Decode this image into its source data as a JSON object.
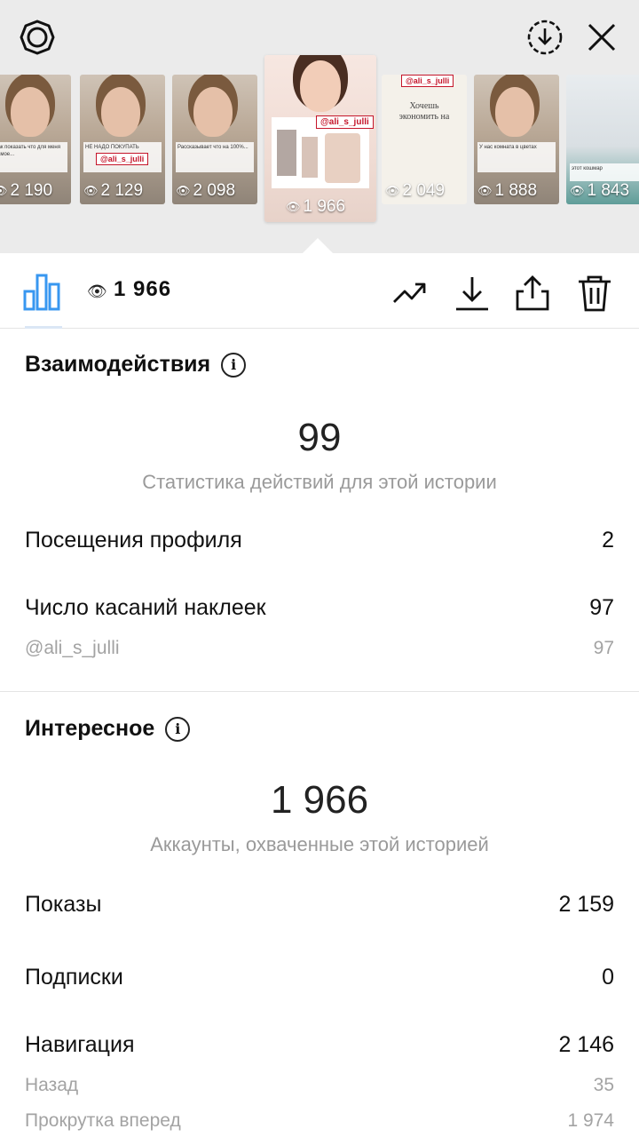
{
  "stories": [
    {
      "views": "2 190",
      "kind": "face",
      "caption": "Как показать что для меня самое..."
    },
    {
      "views": "2 129",
      "kind": "face",
      "caption": "НЕ НАДО ПОКУПАТЬ",
      "tag": "@ali_s_julli"
    },
    {
      "views": "2 098",
      "kind": "face",
      "caption": "Рассказывает что на 100%..."
    },
    {
      "views": "1 966",
      "kind": "selected",
      "tag": "@ali_s_julli",
      "selected": true
    },
    {
      "views": "2 049",
      "kind": "text",
      "caption": "Хочешь экономить на",
      "tag": "@ali_s_julli"
    },
    {
      "views": "1 888",
      "kind": "face",
      "caption": "У нас комната в цветах"
    },
    {
      "views": "1 843",
      "kind": "room",
      "caption": "этот кошмар"
    }
  ],
  "toolbar": {
    "view_count": "1 966"
  },
  "interactions": {
    "title": "Взаимодействия",
    "total": "99",
    "caption": "Статистика действий для этой истории",
    "rows": [
      {
        "label": "Посещения профиля",
        "value": "2"
      },
      {
        "label": "Число касаний наклеек",
        "value": "97"
      },
      {
        "label": "@ali_s_julli",
        "value": "97",
        "sub": true
      }
    ]
  },
  "discovery": {
    "title": "Интересное",
    "total": "1 966",
    "caption": "Аккаунты, охваченные этой историей",
    "rows": [
      {
        "label": "Показы",
        "value": "2 159"
      },
      {
        "label": "Подписки",
        "value": "0"
      },
      {
        "label": "Навигация",
        "value": "2 146"
      },
      {
        "label": "Назад",
        "value": "35",
        "sub": true
      },
      {
        "label": "Прокрутка вперед",
        "value": "1 974",
        "sub": true
      }
    ]
  },
  "colors": {
    "accent": "#3897f0",
    "muted": "#9a9a9a"
  }
}
